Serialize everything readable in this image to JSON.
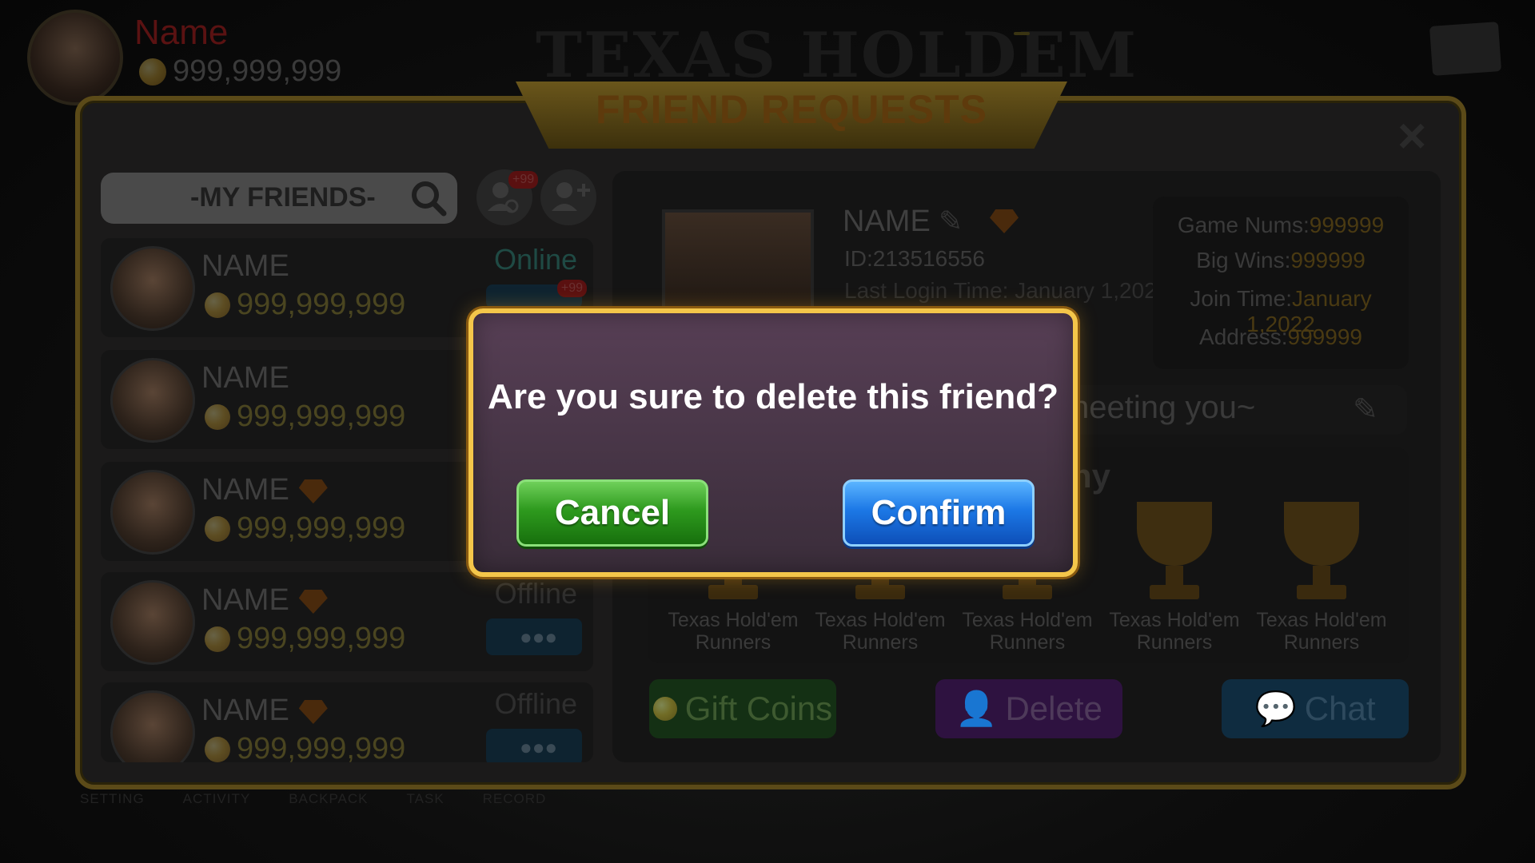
{
  "lobby": {
    "player_name": "Name",
    "player_coins": "999,999,999",
    "game_title": "TEXAS HOLDEM",
    "nav": [
      "SETTING",
      "ACTIVITY",
      "BACKPACK",
      "TASK",
      "RECORD"
    ]
  },
  "panel": {
    "title": "FRIEND REQUESTS",
    "close_symbol": "×",
    "search_label": "-MY FRIENDS-",
    "request_badge": "+99"
  },
  "friends": [
    {
      "name": "NAME",
      "coins": "999,999,999",
      "status": "Online",
      "vip": false,
      "chat_badge": "+99"
    },
    {
      "name": "NAME",
      "coins": "999,999,999",
      "status": "",
      "vip": false
    },
    {
      "name": "NAME",
      "coins": "999,999,999",
      "status": "",
      "vip": true
    },
    {
      "name": "NAME",
      "coins": "999,999,999",
      "status": "Offline",
      "vip": true
    },
    {
      "name": "NAME",
      "coins": "999,999,999",
      "status": "Offline",
      "vip": true
    }
  ],
  "detail": {
    "name": "NAME",
    "id": "ID:213516556",
    "last_login": "Last Login Time: January 1,2022",
    "stats": [
      {
        "label": "Game Nums:",
        "value": "999999"
      },
      {
        "label": "Big Wins:",
        "value": "999999"
      },
      {
        "label": "Join Time:",
        "value": "January 1,2022"
      },
      {
        "label": "Address:",
        "value": "999999"
      }
    ],
    "message": "neeting you~",
    "trophy_heading": "ny",
    "trophies": [
      {
        "line1": "Texas Hold'em",
        "line2": "Runners"
      },
      {
        "line1": "Texas Hold'em",
        "line2": "Runners"
      },
      {
        "line1": "Texas Hold'em",
        "line2": "Runners"
      },
      {
        "line1": "Texas Hold'em",
        "line2": "Runners"
      },
      {
        "line1": "Texas Hold'em",
        "line2": "Runners"
      }
    ],
    "buttons": {
      "gift": "Gift Coins",
      "delete": "Delete",
      "chat": "Chat"
    }
  },
  "dialog": {
    "question": "Are you sure to delete this friend?",
    "cancel": "Cancel",
    "confirm": "Confirm"
  },
  "colors": {
    "dialog_border": "#f4c64a",
    "cancel_green": "#2e9a1e",
    "confirm_blue": "#1c78e6",
    "online_teal": "#1f4a44",
    "offline_grey": "#2e2e2e"
  }
}
